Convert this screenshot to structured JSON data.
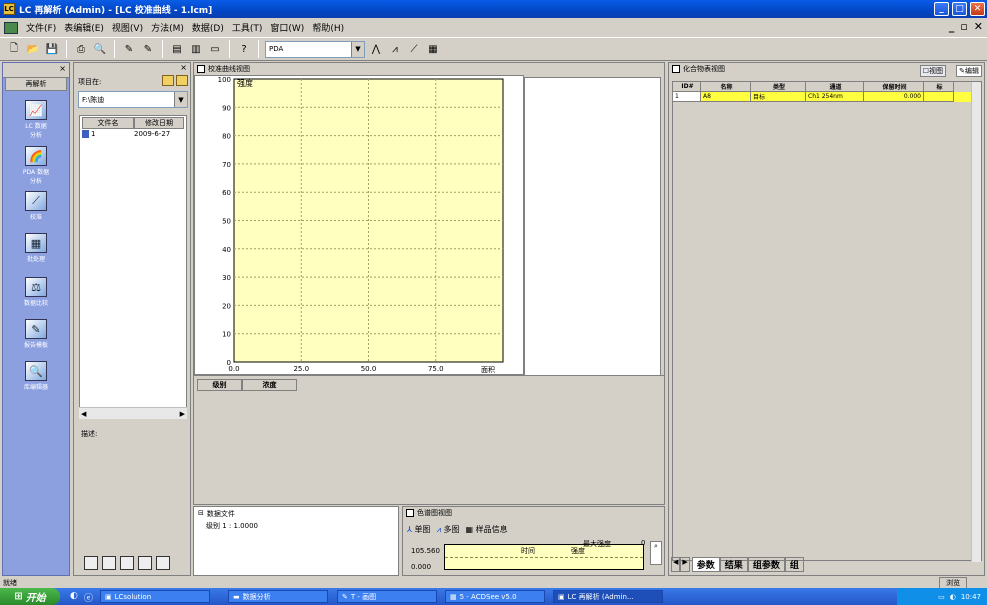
{
  "window": {
    "title": "LC 再解析 (Admin) - [LC 校准曲线 - 1.lcm]",
    "app_icon": "LC"
  },
  "menubar": {
    "items": [
      "文件(F)",
      "表编辑(E)",
      "视图(V)",
      "方法(M)",
      "数据(D)",
      "工具(T)",
      "窗口(W)",
      "帮助(H)"
    ]
  },
  "toolbar": {
    "combo_value": "PDA",
    "icons": [
      "new-icon",
      "open-icon",
      "save-icon",
      "print-icon",
      "print-preview-icon",
      "wizard-icon",
      "wizard2-icon",
      "layout-icon",
      "layout2-icon",
      "layout3-icon",
      "help-icon"
    ]
  },
  "nav": {
    "tab": "再解析",
    "items": [
      {
        "label": "LC 数据\n分析",
        "icon": "lc-data-icon"
      },
      {
        "label": "PDA 数据\n分析",
        "icon": "pda-data-icon"
      },
      {
        "label": "校准",
        "icon": "calibration-icon"
      },
      {
        "label": "批处理",
        "icon": "batch-icon"
      },
      {
        "label": "数据比较",
        "icon": "data-compare-icon"
      },
      {
        "label": "报告模板",
        "icon": "report-template-icon"
      },
      {
        "label": "库编辑器",
        "icon": "library-editor-icon"
      }
    ]
  },
  "project": {
    "lookin_label": "项目在:",
    "path": "F:\\陈迪",
    "col_name": "文件名",
    "col_date": "修改日期",
    "files": [
      {
        "name": "1",
        "date": "2009-6-27"
      }
    ],
    "desc_label": "描述:"
  },
  "calibration": {
    "pane_title": "校准曲线视图",
    "table_cols": [
      "级别",
      "浓度"
    ]
  },
  "chart_data": {
    "type": "scatter",
    "title": "",
    "ylabel": "强度",
    "xlabel": "面积",
    "ylim": [
      0,
      100
    ],
    "xlim": [
      0,
      100
    ],
    "x_ticks": [
      "0.0",
      "25.0",
      "50.0",
      "75.0"
    ],
    "y_ticks": [
      "0",
      "10",
      "20",
      "30",
      "40",
      "50",
      "60",
      "70",
      "80",
      "90",
      "100"
    ],
    "series": [],
    "grid": true
  },
  "datafile": {
    "title": "数据文件",
    "entry": "级别 1 : 1.0000"
  },
  "colormap": {
    "title": "色谱图视图",
    "tabs": [
      "单图",
      "多图",
      "样品信息"
    ],
    "max_label": "最大强度",
    "max_value": "0",
    "x_label": "时间",
    "y_label": "强度",
    "y_top": "105.560",
    "y_bottom": "0.000"
  },
  "compound": {
    "title": "化合物表视图",
    "view_btn": "视图",
    "edit_btn": "编辑",
    "columns": [
      "ID#",
      "名称",
      "类型",
      "通道",
      "保留时间",
      "标"
    ],
    "rows": [
      {
        "id": "1",
        "name": "A8",
        "type": "目标",
        "channel": "Ch1 254nm",
        "rt": "0.000",
        "std": ""
      }
    ],
    "tabs": [
      "参数",
      "结果",
      "组参数",
      "组"
    ]
  },
  "status": {
    "text": "就绪",
    "right": "浏览"
  },
  "taskbar": {
    "start": "开始",
    "tasks": [
      "LCsolution",
      "数据分析",
      "T - 画图",
      "5 - ACDSee v5.0",
      "LC 再解析 (Admin..."
    ],
    "clock": "10:47"
  }
}
